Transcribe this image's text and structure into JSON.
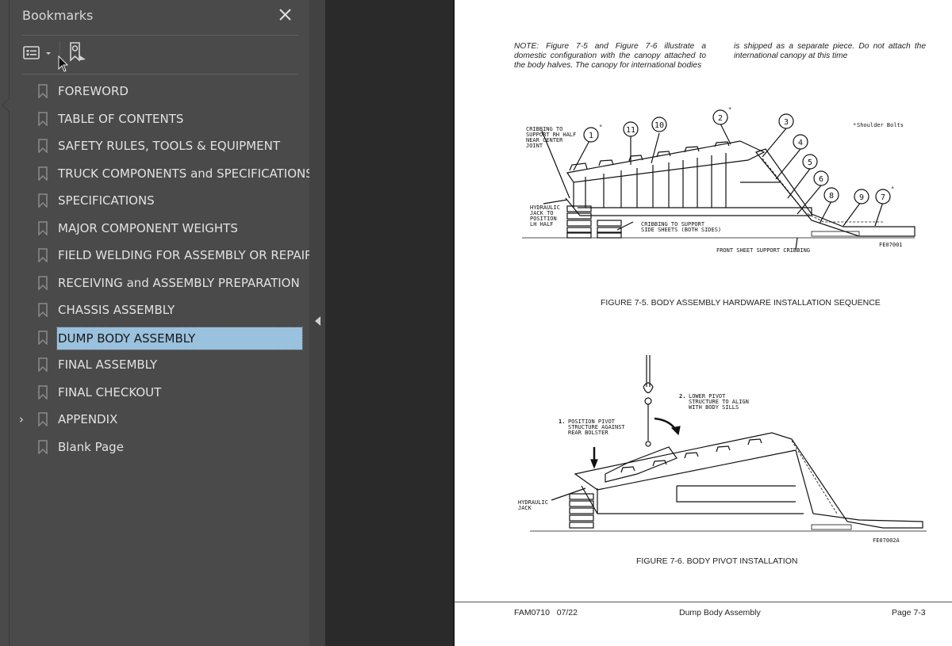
{
  "bookmarks_panel": {
    "title": "Bookmarks",
    "close_icon": "close-icon",
    "toolbar": {
      "options_icon": "list-options-icon",
      "dropdown_icon": "chevron-down-icon",
      "find_bookmark_icon": "find-current-bookmark-icon"
    },
    "items": [
      {
        "label": "FOREWORD",
        "expandable": false,
        "selected": false
      },
      {
        "label": "TABLE OF CONTENTS",
        "expandable": false,
        "selected": false
      },
      {
        "label": "SAFETY RULES, TOOLS & EQUIPMENT",
        "expandable": false,
        "selected": false
      },
      {
        "label": "TRUCK COMPONENTS and SPECIFICATIONS",
        "expandable": false,
        "selected": false
      },
      {
        "label": "SPECIFICATIONS",
        "expandable": false,
        "selected": false
      },
      {
        "label": "MAJOR COMPONENT WEIGHTS",
        "expandable": false,
        "selected": false
      },
      {
        "label": "FIELD WELDING FOR ASSEMBLY OR REPAIR",
        "expandable": false,
        "selected": false
      },
      {
        "label": "RECEIVING and ASSEMBLY PREPARATION",
        "expandable": false,
        "selected": false
      },
      {
        "label": "CHASSIS ASSEMBLY",
        "expandable": false,
        "selected": false
      },
      {
        "label": "DUMP BODY ASSEMBLY",
        "expandable": false,
        "selected": true
      },
      {
        "label": "FINAL ASSEMBLY",
        "expandable": false,
        "selected": false
      },
      {
        "label": "FINAL CHECKOUT",
        "expandable": false,
        "selected": false
      },
      {
        "label": "APPENDIX",
        "expandable": true,
        "selected": false
      },
      {
        "label": "Blank Page",
        "expandable": false,
        "selected": false
      }
    ],
    "expander_glyph": "›",
    "collapse_icon": "collapse-panel-arrow-icon"
  },
  "document": {
    "note_col1": "NOTE: Figure 7-5 and Figure 7-6 illustrate a domestic configuration with the canopy attached to the body halves. The canopy for international bodies",
    "note_col2": "is shipped as a separate piece. Do not attach the international canopy at this time",
    "figure1": {
      "caption": "FIGURE 7-5. BODY ASSEMBLY HARDWARE INSTALLATION SEQUENCE",
      "callouts": [
        "1",
        "11",
        "10",
        "2",
        "3",
        "4",
        "5",
        "6",
        "8",
        "9",
        "7"
      ],
      "starred_callouts": [
        "1",
        "2",
        "7"
      ],
      "legend": "Shoulder Bolts",
      "label_cribbing_rh": [
        "CRIBBING TO",
        "SUPPORT RH HALF",
        "NEAR CENTER",
        "JOINT"
      ],
      "label_jack": [
        "HYDRAULIC",
        "JACK TO",
        "POSITION",
        "LH HALF"
      ],
      "label_cribbing_side": [
        "CRIBBING TO SUPPORT",
        "SIDE SHEETS (BOTH SIDES)"
      ],
      "label_front_cribbing": "FRONT SHEET SUPPORT CRIBBING",
      "drawing_id": "FE07001"
    },
    "figure2": {
      "caption": "FIGURE 7-6. BODY PIVOT INSTALLATION",
      "step1_num": "1.",
      "step1": [
        "POSITION  PIVOT",
        "STRUCTURE AGAINST",
        "REAR BOLSTER"
      ],
      "step2_num": "2.",
      "step2": [
        "LOWER PIVOT",
        "STRUCTURE TO ALIGN",
        "WITH BODY SILLS"
      ],
      "label_jack": [
        "HYDRAULIC",
        "JACK"
      ],
      "drawing_id": "FE07002A"
    },
    "footer": {
      "doc_id": "FAM0710   07/22",
      "section": "Dump Body Assembly",
      "page": "Page 7-3"
    }
  }
}
